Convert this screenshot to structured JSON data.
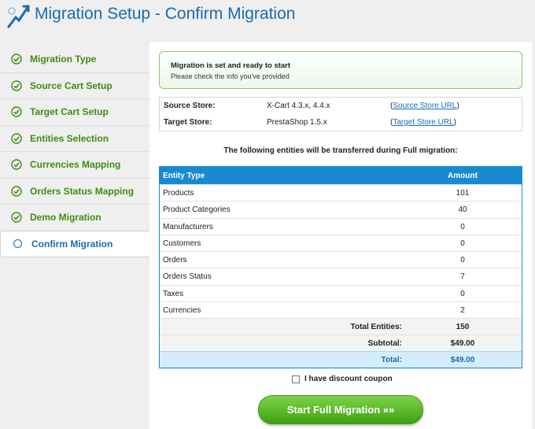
{
  "header": {
    "title": "Migration Setup - Confirm Migration"
  },
  "sidebar": {
    "steps": [
      {
        "label": "Migration Type",
        "state": "done"
      },
      {
        "label": "Source Cart Setup",
        "state": "done"
      },
      {
        "label": "Target Cart Setup",
        "state": "done"
      },
      {
        "label": "Entities Selection",
        "state": "done"
      },
      {
        "label": "Currencies Mapping",
        "state": "done"
      },
      {
        "label": "Orders Status Mapping",
        "state": "done"
      },
      {
        "label": "Demo Migration",
        "state": "done"
      },
      {
        "label": "Confirm Migration",
        "state": "active"
      }
    ]
  },
  "notice": {
    "title": "Migration is set and ready to start",
    "text": "Please check the info you've provided"
  },
  "stores": {
    "source": {
      "label": "Source Store:",
      "value": "X-Cart 4.3.x, 4.4.x",
      "link": "Source Store URL"
    },
    "target": {
      "label": "Target Store:",
      "value": "PrestaShop 1.5.x",
      "link": "Target Store URL"
    }
  },
  "entities": {
    "heading": "The following entities will be transferred during Full migration:",
    "header": {
      "type": "Entity Type",
      "amount": "Amount"
    },
    "rows": [
      {
        "name": "Products",
        "amount": "101"
      },
      {
        "name": "Product Categories",
        "amount": "40"
      },
      {
        "name": "Manufacturers",
        "amount": "0"
      },
      {
        "name": "Customers",
        "amount": "0"
      },
      {
        "name": "Orders",
        "amount": "0"
      },
      {
        "name": "Orders Status",
        "amount": "7"
      },
      {
        "name": "Taxes",
        "amount": "0"
      },
      {
        "name": "Currencies",
        "amount": "2"
      }
    ],
    "total_entities": {
      "label": "Total Entities:",
      "value": "150"
    },
    "subtotal": {
      "label": "Subtotal:",
      "value": "$49.00"
    },
    "total": {
      "label": "Total:",
      "value": "$49.00"
    }
  },
  "coupon": {
    "label": "I have discount coupon",
    "checked": false
  },
  "start_button": {
    "label": "Start Full Migration »»"
  },
  "colors": {
    "accent": "#1a6bb0",
    "success": "#3f8c12",
    "table_header": "#1a8ad0",
    "button": "#4fb21e"
  }
}
